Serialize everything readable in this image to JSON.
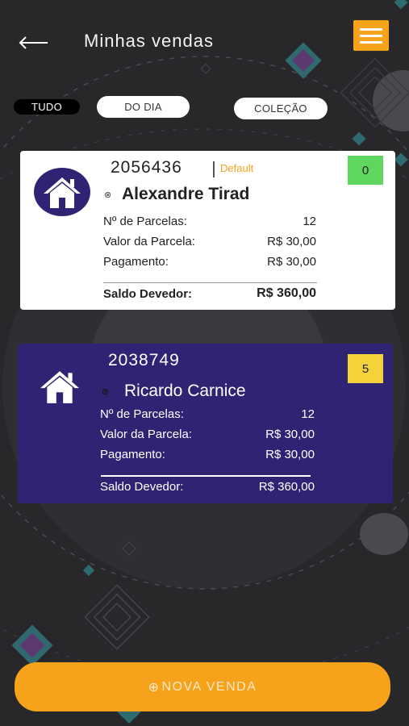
{
  "header": {
    "title": "Minhas vendas"
  },
  "filters": {
    "all": "TUDO",
    "day": "DO DIA",
    "collection": "COLEÇÃO"
  },
  "sales": [
    {
      "code": "2056436",
      "tag": "Default",
      "badge": "0",
      "name": "Alexandre Tirad",
      "installments_label": "Nº de Parcelas:",
      "installments_value": "12",
      "installment_value_label": "Valor da Parcela:",
      "installment_value": "R$ 30,00",
      "payment_label": "Pagamento:",
      "payment_value": "R$ 30,00",
      "balance_label": "Saldo Devedor:",
      "balance_value": "R$ 360,00"
    },
    {
      "code": "2038749",
      "badge": "5",
      "name": "Ricardo Carnice",
      "installments_label": "Nº de Parcelas:",
      "installments_value": "12",
      "installment_value_label": "Valor da Parcela:",
      "installment_value": "R$ 30,00",
      "payment_label": "Pagamento:",
      "payment_value": "R$ 30,00",
      "balance_label": "Saldo Devedor:",
      "balance_value": "R$ 360,00"
    }
  ],
  "fab": {
    "label": "NOVA VENDA"
  },
  "colors": {
    "background": "#28282b",
    "accent": "#f7a21b",
    "card_dark": "#2e2473",
    "badge_green": "#5fd75f",
    "badge_yellow": "#f4d33a"
  },
  "icons": {
    "back": "arrow-left-icon",
    "menu": "hamburger-icon",
    "house": "house-icon",
    "status": "circle-x-icon",
    "add": "plus-circle-icon"
  }
}
